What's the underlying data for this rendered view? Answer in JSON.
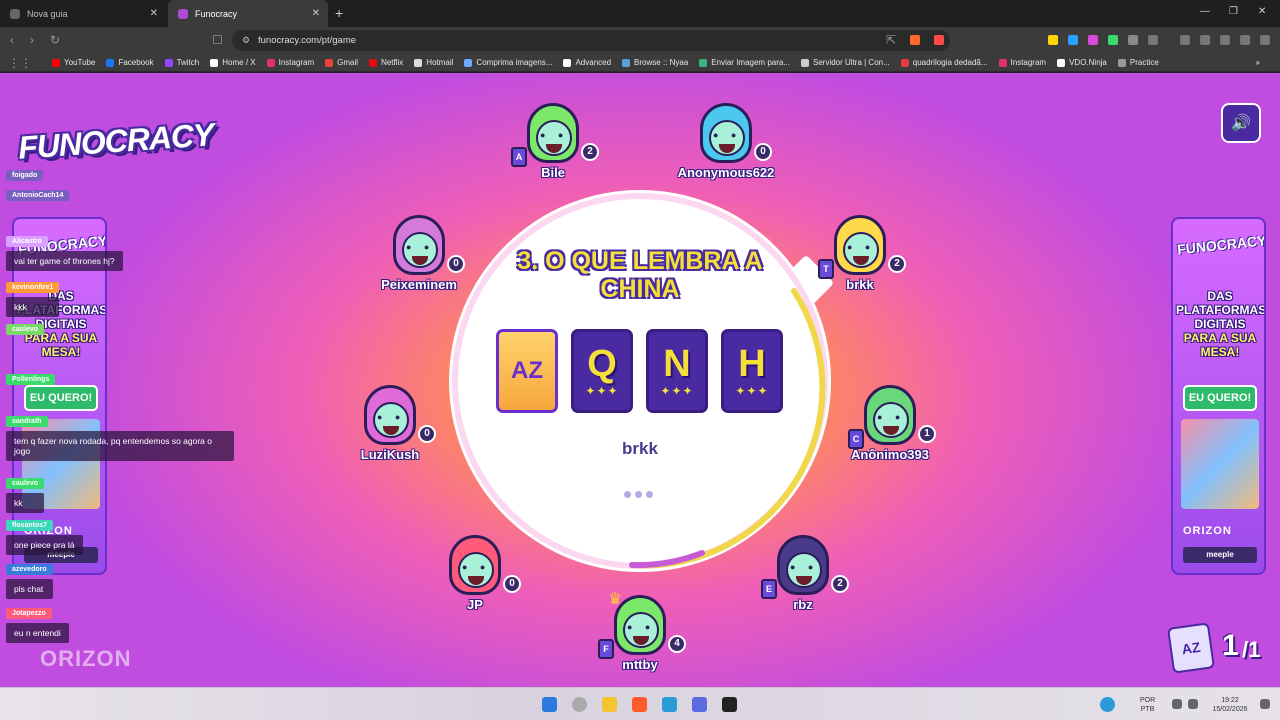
{
  "browser": {
    "tabs": [
      {
        "label": "Nova guia"
      },
      {
        "label": "Funocracy"
      }
    ],
    "url": "funocracy.com/pt/game",
    "bookmarks": [
      {
        "label": "YouTube",
        "color": "#ff0000"
      },
      {
        "label": "Facebook",
        "color": "#1877f2"
      },
      {
        "label": "Twitch",
        "color": "#9146ff"
      },
      {
        "label": "Home / X",
        "color": "#ffffff"
      },
      {
        "label": "Instagram",
        "color": "#e1306c"
      },
      {
        "label": "Gmail",
        "color": "#ea4335"
      },
      {
        "label": "Netflix",
        "color": "#e50914"
      },
      {
        "label": "Hotmail",
        "color": "#dddddd"
      },
      {
        "label": "Comprima imagens...",
        "color": "#6fa8ff"
      },
      {
        "label": "Advanced",
        "color": "#ffffff"
      },
      {
        "label": "Browse :: Nyaa",
        "color": "#5aa0d8"
      },
      {
        "label": "Enviar Imagem para...",
        "color": "#3bb37b"
      },
      {
        "label": "Servidor Ultra | Con...",
        "color": "#cccccc"
      },
      {
        "label": "quadrilogia dedadã...",
        "color": "#e23b3b"
      },
      {
        "label": "Instagram",
        "color": "#e1306c"
      },
      {
        "label": "VDO.Ninja",
        "color": "#ffffff"
      },
      {
        "label": "Practice",
        "color": "#999999"
      }
    ]
  },
  "game": {
    "logo": "FUNOCRACY",
    "question": "3. O QUE LEMBRA A CHINA",
    "cards": [
      {
        "type": "rotate",
        "label": "AZ"
      },
      {
        "type": "letter",
        "label": "Q",
        "stars": "✦✦✦"
      },
      {
        "type": "letter",
        "label": "N",
        "stars": "✦✦✦"
      },
      {
        "type": "letter",
        "label": "H",
        "stars": "✦✦✦"
      }
    ],
    "current_player": "brkk",
    "round_counter": {
      "current": "1",
      "total": "/1"
    },
    "players": [
      {
        "name": "Bile",
        "score": "2",
        "badge": "A",
        "hair": "#7be86a"
      },
      {
        "name": "Anonymous622",
        "score": "0",
        "badge": "",
        "hair": "#4ac8f0"
      },
      {
        "name": "Peixeminem",
        "score": "0",
        "badge": "",
        "hair": "#d47ad8"
      },
      {
        "name": "brkk",
        "score": "2",
        "badge": "T",
        "hair": "#ffd94a"
      },
      {
        "name": "LuziKush",
        "score": "0",
        "badge": "",
        "hair": "#e06ad8"
      },
      {
        "name": "Anônimo393",
        "score": "1",
        "badge": "C",
        "hair": "#6ad87a"
      },
      {
        "name": "JP",
        "score": "0",
        "badge": "",
        "hair": "#ff5a7a"
      },
      {
        "name": "rbz",
        "score": "2",
        "badge": "E",
        "hair": "#4a3a8a"
      },
      {
        "name": "mttby",
        "score": "4",
        "badge": "F",
        "hair": "#7be86a"
      }
    ],
    "banner": {
      "logo": "FUNOCRACY",
      "text_line1": "DAS",
      "text_line2": "PLATAFORMAS",
      "text_line3": "DIGITAIS",
      "text_line4": "PARA A SUA",
      "text_line5": "MESA!",
      "button": "EU QUERO!",
      "footer1": "ORIZON",
      "footer2": "meeple"
    },
    "watermark": "ORIZON"
  },
  "chat": {
    "messages": [
      {
        "user": "foigado",
        "text": "",
        "color": "#7a5fc0"
      },
      {
        "user": "AntonioCach14",
        "text": "",
        "color": "#7a5fc0"
      },
      {
        "user": "Alicastro",
        "text": "vai ter game of thrones hj?",
        "color": "#d9a0ff"
      },
      {
        "user": "kevinonfire1",
        "text": "kkk",
        "color": "#ff9a3a"
      },
      {
        "user": "caulevo",
        "text": "",
        "color": "#7ad86a"
      },
      {
        "user": "Pollenlings",
        "text": "",
        "color": "#3adb6a"
      },
      {
        "user": "sandrath",
        "text": "tem q fazer nova rodada, pq entendemos so agora o jogo",
        "color": "#3adb6a"
      },
      {
        "user": "caulevo",
        "text": "kk",
        "color": "#3adb6a"
      },
      {
        "user": "flosantos7",
        "text": "one piece pra lá",
        "color": "#3ad8b8"
      },
      {
        "user": "azevedoro",
        "text": "pls chat",
        "color": "#3a7adb"
      },
      {
        "user": "Jotapezzo",
        "text": "eu n entendi",
        "color": "#ff5a7a"
      }
    ]
  },
  "taskbar": {
    "lang": "POR",
    "layout": "PTB",
    "time": "19:22",
    "date": "15/02/2026"
  }
}
